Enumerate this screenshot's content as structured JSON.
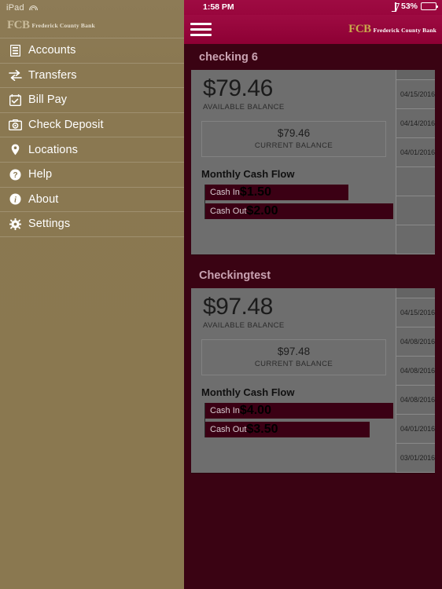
{
  "device_status": {
    "left_label": "iPad",
    "wifi_icon": "wifi-icon",
    "time": "1:58 PM",
    "bluetooth_icon": "bluetooth-icon",
    "battery_percent": "53%",
    "battery_icon": "battery-icon"
  },
  "sidebar": {
    "logo": {
      "mark": "FCB",
      "name": "Frederick County Bank"
    },
    "items": [
      {
        "label": "Accounts",
        "icon": "accounts-icon"
      },
      {
        "label": "Transfers",
        "icon": "transfers-icon"
      },
      {
        "label": "Bill Pay",
        "icon": "billpay-icon"
      },
      {
        "label": "Check Deposit",
        "icon": "camera-icon"
      },
      {
        "label": "Locations",
        "icon": "map-pin-icon"
      },
      {
        "label": "Help",
        "icon": "question-icon"
      },
      {
        "label": "About",
        "icon": "info-icon"
      },
      {
        "label": "Settings",
        "icon": "gear-icon"
      }
    ]
  },
  "header": {
    "menu_icon": "hamburger-icon",
    "logo": {
      "mark": "FCB",
      "name": "Frederick County Bank"
    }
  },
  "accounts": [
    {
      "title": "checking 6",
      "available_amount": "$79.46",
      "available_label": "AVAILABLE BALANCE",
      "current_amount": "$79.46",
      "current_label": "CURRENT BALANCE",
      "cashflow_title": "Monthly Cash Flow",
      "cash_in_label": "Cash In",
      "cash_in_value": "$1.50",
      "cash_out_label": "Cash Out",
      "cash_out_value": "$2.00",
      "transactions": [
        "04/15/2016",
        "04/14/2016",
        "04/01/2016",
        "",
        "",
        ""
      ]
    },
    {
      "title": "Checkingtest",
      "available_amount": "$97.48",
      "available_label": "AVAILABLE BALANCE",
      "current_amount": "$97.48",
      "current_label": "CURRENT BALANCE",
      "cashflow_title": "Monthly Cash Flow",
      "cash_in_label": "Cash In",
      "cash_in_value": "$4.00",
      "cash_out_label": "Cash Out",
      "cash_out_value": "$3.50",
      "transactions": [
        "04/15/2016",
        "04/08/2016",
        "04/08/2016",
        "04/08/2016",
        "04/01/2016",
        "03/01/2016"
      ]
    }
  ],
  "chart_data": [
    {
      "type": "bar",
      "title": "Monthly Cash Flow",
      "account": "checking 6",
      "categories": [
        "Cash In",
        "Cash Out"
      ],
      "values": [
        1.5,
        2.0
      ],
      "xlabel": "",
      "ylabel": "",
      "xlim": [
        0,
        2.0
      ],
      "orientation": "horizontal",
      "grid": false,
      "legend": "none"
    },
    {
      "type": "bar",
      "title": "Monthly Cash Flow",
      "account": "Checkingtest",
      "categories": [
        "Cash In",
        "Cash Out"
      ],
      "values": [
        4.0,
        3.5
      ],
      "xlabel": "",
      "ylabel": "",
      "xlim": [
        0,
        4.0
      ],
      "orientation": "horizontal",
      "grid": false,
      "legend": "none"
    }
  ],
  "colors": {
    "brand_maroon": "#3a0313",
    "header_crimson": "#9e0b42",
    "sidebar_tan": "#8a7851",
    "card_gray": "#6e6e6e",
    "bar_dark": "#3b0014",
    "logo_gold": "#c8a84b"
  }
}
